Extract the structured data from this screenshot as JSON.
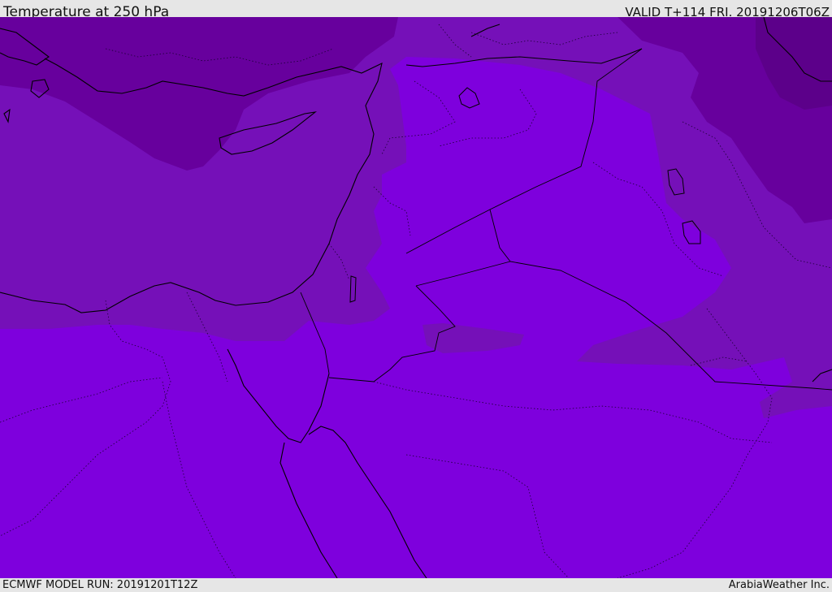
{
  "header": {
    "title": "Temperature at 250 hPa",
    "valid": "VALID T+114 FRI. 20191206T06Z"
  },
  "footer": {
    "model_run": "ECMWF MODEL RUN: 20191201T12Z",
    "credit": "ArabiaWeather Inc."
  },
  "map": {
    "region": "Eastern Mediterranean and Middle East",
    "temperature_band_colors": {
      "warmest": "#7e00dd",
      "mid": "#7510b8",
      "cold": "#67009d",
      "coldest": "#5c008a"
    },
    "line_colors": {
      "coastline": "#000000",
      "border": "#000000"
    }
  }
}
